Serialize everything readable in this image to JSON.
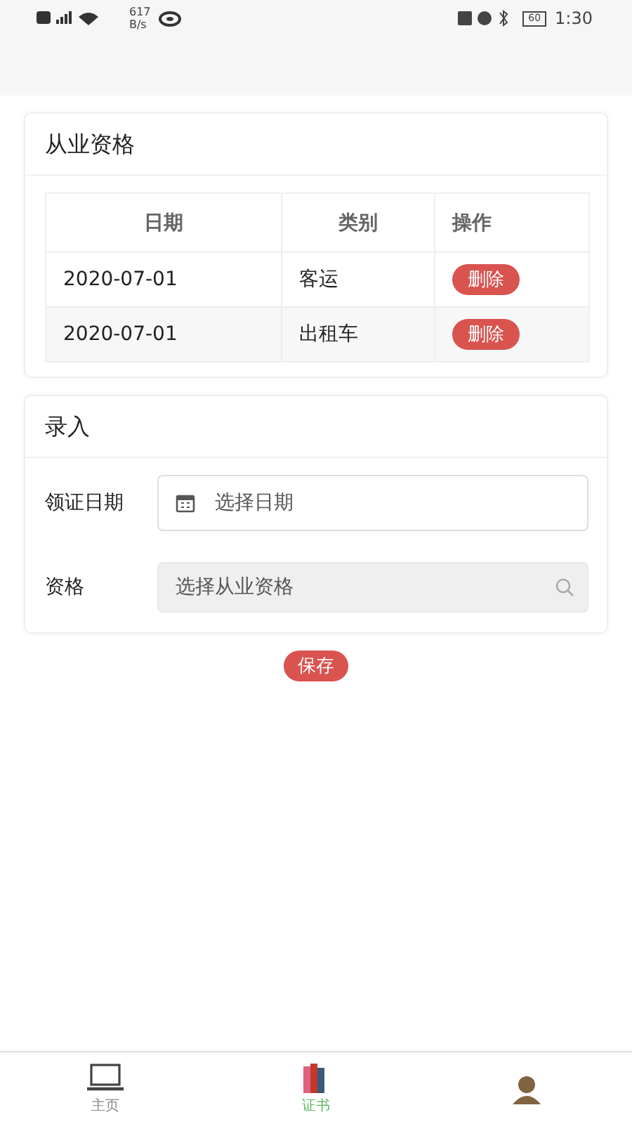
{
  "status_bar": {
    "speed": "617",
    "speed_unit": "B/s",
    "battery": "60",
    "time": "1:30"
  },
  "qualifications": {
    "title": "从业资格",
    "columns": [
      "日期",
      "类别",
      "操作"
    ],
    "rows": [
      {
        "date": "2020-07-01",
        "category": "客运",
        "action": "删除"
      },
      {
        "date": "2020-07-01",
        "category": "出租车",
        "action": "删除"
      }
    ]
  },
  "entry": {
    "title": "录入",
    "fields": [
      {
        "kind": "date",
        "label": "领证日期",
        "placeholder": "选择日期"
      },
      {
        "kind": "search",
        "label": "资格",
        "placeholder": "选择从业资格"
      }
    ]
  },
  "save_button": "保存",
  "tabs": [
    {
      "kind": "laptop",
      "label": "主页",
      "selected": false
    },
    {
      "kind": "books",
      "label": "证书",
      "selected": true
    },
    {
      "kind": "person",
      "selected": false
    }
  ]
}
